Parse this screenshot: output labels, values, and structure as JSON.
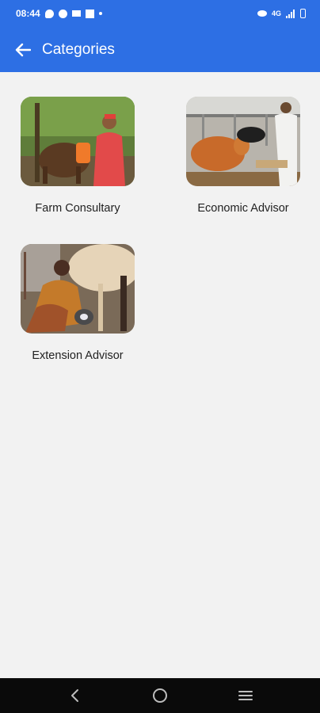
{
  "status_bar": {
    "time": "08:44",
    "network": "4G"
  },
  "header": {
    "title": "Categories"
  },
  "categories": [
    {
      "label": "Farm Consultary",
      "image": "farmer-with-cow-and-milk-can"
    },
    {
      "label": "Economic Advisor",
      "image": "man-feeding-cows-in-shed"
    },
    {
      "label": "Extension Advisor",
      "image": "woman-milking-cow"
    }
  ],
  "colors": {
    "appbar": "#2d6fe4",
    "background": "#f2f2f2",
    "navbar": "#0a0a0a"
  }
}
